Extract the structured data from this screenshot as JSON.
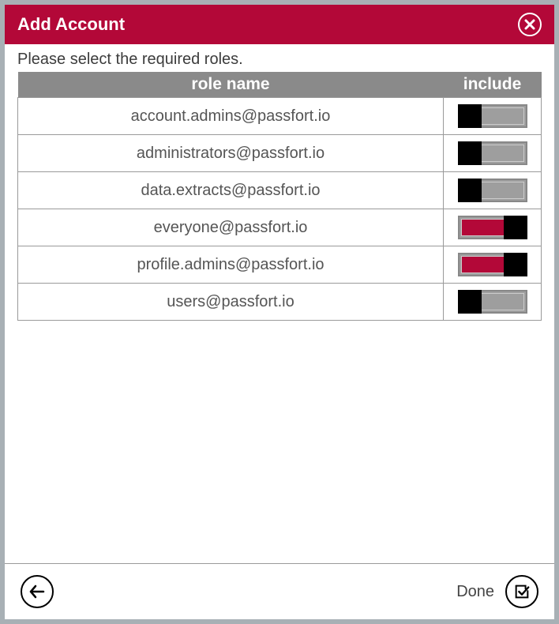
{
  "header": {
    "title": "Add Account"
  },
  "instruction": "Please select the required roles.",
  "table": {
    "headers": {
      "role": "role name",
      "include": "include"
    },
    "rows": [
      {
        "role": "account.admins@passfort.io",
        "included": false
      },
      {
        "role": "administrators@passfort.io",
        "included": false
      },
      {
        "role": "data.extracts@passfort.io",
        "included": false
      },
      {
        "role": "everyone@passfort.io",
        "included": true
      },
      {
        "role": "profile.admins@passfort.io",
        "included": true
      },
      {
        "role": "users@passfort.io",
        "included": false
      }
    ]
  },
  "footer": {
    "done_label": "Done"
  }
}
